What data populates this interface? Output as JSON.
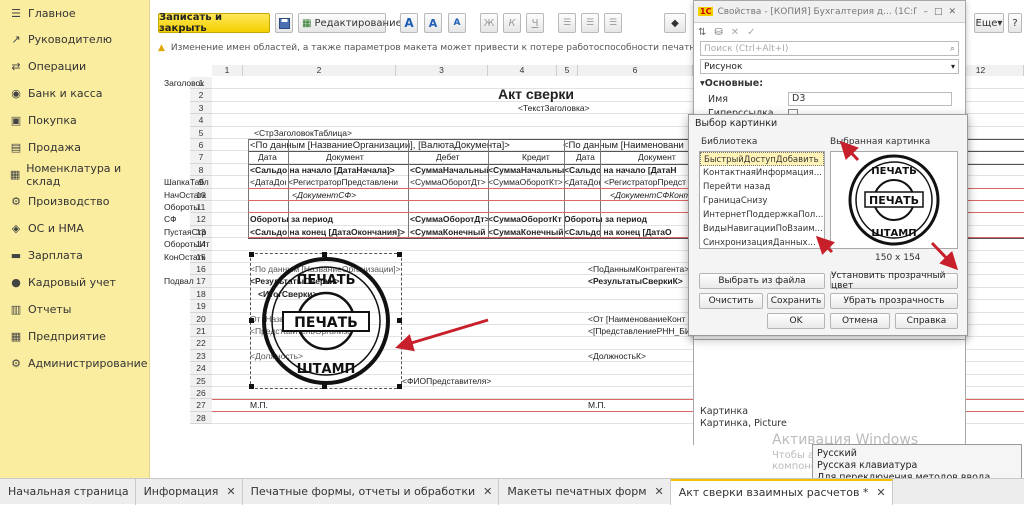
{
  "sidebar": {
    "items": [
      {
        "label": "Главное",
        "icon": "menu-icon"
      },
      {
        "label": "Руководителю",
        "icon": "chart-line-icon"
      },
      {
        "label": "Операции",
        "icon": "operations-icon"
      },
      {
        "label": "Банк и касса",
        "icon": "bank-icon"
      },
      {
        "label": "Покупка",
        "icon": "cart-icon"
      },
      {
        "label": "Продажа",
        "icon": "bag-icon"
      },
      {
        "label": "Номенклатура и склад",
        "icon": "warehouse-icon"
      },
      {
        "label": "Производство",
        "icon": "factory-icon"
      },
      {
        "label": "ОС и НМА",
        "icon": "assets-icon"
      },
      {
        "label": "Зарплата",
        "icon": "wallet-icon"
      },
      {
        "label": "Кадровый учет",
        "icon": "people-icon"
      },
      {
        "label": "Отчеты",
        "icon": "report-icon"
      },
      {
        "label": "Предприятие",
        "icon": "enterprise-icon"
      },
      {
        "label": "Администрирование",
        "icon": "gear-icon"
      }
    ]
  },
  "toolbar": {
    "save_close": "Записать и закрыть",
    "edit": "Редактирование",
    "more": "Еще",
    "help": "?",
    "font_a_big": "A",
    "font_a_mid": "A",
    "font_a_small": "A",
    "bold": "Ж",
    "italic": "К",
    "underline": "Ч"
  },
  "warning": "Изменение имен областей, а также параметров макета может привести к потере работоспособности печатной формы.",
  "sheet": {
    "columns": [
      "1",
      "2",
      "3",
      "4",
      "5",
      "6",
      "12"
    ],
    "rows": [
      "1",
      "2",
      "3",
      "4",
      "5",
      "6",
      "7",
      "8",
      "9",
      "10",
      "11",
      "12",
      "13",
      "14",
      "15",
      "16",
      "17",
      "18",
      "19",
      "20",
      "21",
      "22",
      "23",
      "24",
      "25",
      "26",
      "27",
      "28"
    ],
    "areas": [
      "Заголовок",
      "ШапкаТабл",
      "НачОстатк",
      "Обороты",
      "СФ",
      "ПустаяСтр",
      "ОборотыИт",
      "КонОстатк",
      "Подвал"
    ],
    "title": "Акт сверки",
    "subtitle": "<ТекстЗаголовка>",
    "header_table": "<СтрЗаголовокТаблица>",
    "by_org": "<По данным [НазваниеОрганизации], [ВалютаДокумента]>",
    "by_other": "<По данным [Наименовани",
    "col_date": "Дата",
    "col_doc": "Документ",
    "col_debit": "Дебет",
    "col_credit": "Кредит",
    "col_date2": "Дата",
    "col_doc2": "Документ",
    "saldo_start": "<Сальдо на начало [ДатаНачала]>",
    "sum_start": "<СуммаНачальный",
    "sum_start2": "<СуммаНачальный",
    "saldo_start2": "<Сальдо на начало [ДатаН",
    "date_doc": "<ДатаДокум",
    "registrator": "<РегистраторПредставлени",
    "sum_turn_dt": "<СуммаОборотДт>",
    "sum_turn_kt": "<СуммаОборотКт>",
    "date_doc2": "<ДатаДок",
    "registrator2": "<РегистраторПредст",
    "doc_sf": "<ДокументСФ>",
    "doc_sf2": "<ДокументСФКонтр",
    "turnover": "Обороты за период",
    "sum_turn_dt2": "<СуммаОборотДт>",
    "sum_turn_kt2": "<СуммаОборотКт",
    "turnover2": "Обороты за период",
    "saldo_end": "<Сальдо на конец [ДатаОкончания]>",
    "sum_end": "<СуммаКонечный",
    "sum_end2": "<СуммаКонечный",
    "saldo_end2": "<Сальдо на конец [ДатаО",
    "footer_data_org": "<По данным [НазваниеОрганизации]>",
    "footer_results": "<РезультатыСверки>",
    "footer_act": "<ИтогСверки>",
    "footer_org": "От [НазваниеОрганизации]",
    "footer_rep": "<ПредставительОрганиза",
    "footer_position": "<Должность>",
    "footer_fio": "<ФИОПредставителя>",
    "mp": "М.П.",
    "mp2": "М.П.",
    "contr_data": "<ПоДаннымКонтрагента>",
    "contr_results": "<РезультатыСверкиК>",
    "contr_org": "<От [НаименованиеКонт",
    "contr_rep": "<[ПредставлениеРНН_БИ",
    "contr_position": "<ДолжностьК>"
  },
  "stamp": {
    "top": "ПЕЧАТЬ",
    "center": "ПЕЧАТЬ",
    "bottom": "ШТАМП"
  },
  "props": {
    "title": "Свойства - [КОПИЯ] Бухгалтерия д... (1С:Предприятие)",
    "search_placeholder": "Поиск (Ctrl+Alt+I)",
    "type_value": "Рисунок",
    "section": "Основные:",
    "name_label": "Имя",
    "name_value": "D3",
    "hyperlink_label": "Гиперссылка",
    "bottom_label": "Картинка",
    "bottom_value": "Картинка, Picture"
  },
  "picker": {
    "title": "Выбор картинки",
    "library_label": "Библиотека",
    "selected_label": "Выбранная картинка",
    "library_items": [
      "БыстрыйДоступДобавить",
      "КонтактнаяИнформация...",
      "Перейти назад",
      "ГраницаСнизу",
      "ИнтернетПоддержкаПол...",
      "ВидыНавигацииПоВзаим...",
      "СинхронизацияДанных..."
    ],
    "size": "150 x 154",
    "btn_from_file": "Выбрать из файла",
    "btn_transparent": "Установить прозрачный цвет",
    "btn_clear": "Очистить",
    "btn_save": "Сохранить",
    "btn_remove_transparency": "Убрать прозрачность",
    "btn_ok": "OK",
    "btn_cancel": "Отмена",
    "btn_help": "Справка"
  },
  "lang_popup": {
    "line1": "Русский",
    "line2": "Русская клавиатура",
    "line3": "Для переключения методов ввода нажмите",
    "line4": "WINDOWS+ПРОБЕЛ."
  },
  "watermark": {
    "title": "Активация Windows",
    "text": "Чтобы активировать Windows, перейдите в компонент панели управления \"Система\"."
  },
  "tabs": [
    {
      "label": "Начальная страница",
      "closable": false
    },
    {
      "label": "Информация",
      "closable": true
    },
    {
      "label": "Печатные формы, отчеты и обработки",
      "closable": true
    },
    {
      "label": "Макеты печатных форм",
      "closable": true
    },
    {
      "label": "Акт сверки взаимных расчетов *",
      "closable": true,
      "active": true
    }
  ],
  "colors": {
    "sidebar": "#fbeda0",
    "accent": "#f3cf00",
    "arrow": "#c8202a"
  }
}
